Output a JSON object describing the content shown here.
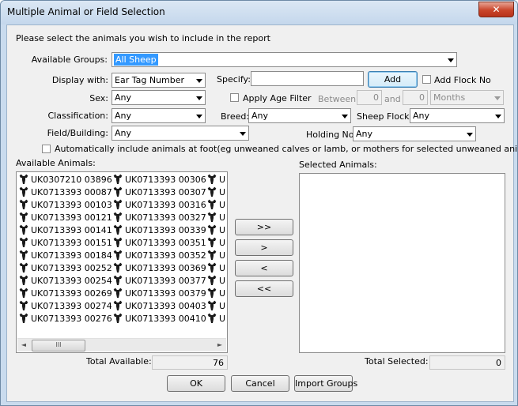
{
  "window": {
    "title": "Multiple Animal or Field Selection",
    "close": "✕"
  },
  "instructions": "Please select the animals you wish to include in the report",
  "groups": {
    "label": "Available Groups:",
    "value": "All Sheep"
  },
  "display": {
    "label": "Display with:",
    "value": "Ear Tag Number"
  },
  "specify": {
    "label": "Specify:",
    "value": ""
  },
  "add_button": "Add",
  "add_flock": "Add Flock No",
  "sex": {
    "label": "Sex:",
    "value": "Any"
  },
  "age_filter": {
    "label": "Apply Age Filter",
    "between": "Between",
    "and": "and",
    "from": "0",
    "to": "0",
    "unit": "Months"
  },
  "classification": {
    "label": "Classification:",
    "value": "Any"
  },
  "breed": {
    "label": "Breed:",
    "value": "Any"
  },
  "flock": {
    "label": "Sheep Flock:",
    "value": "Any"
  },
  "field": {
    "label": "Field/Building:",
    "value": "Any"
  },
  "holding": {
    "label": "Holding No:",
    "value": "Any"
  },
  "auto_include": "Automatically include animals at foot(eg unweaned calves or lamb, or mothers for selected unweaned animals)",
  "available": {
    "label": "Available Animals:",
    "columns": [
      [
        "UK0307210 03896",
        "UK0713393 00087",
        "UK0713393 00103",
        "UK0713393 00121",
        "UK0713393 00141",
        "UK0713393 00151",
        "UK0713393 00184",
        "UK0713393 00252",
        "UK0713393 00254",
        "UK0713393 00269",
        "UK0713393 00274",
        "UK0713393 00276"
      ],
      [
        "UK0713393 00306",
        "UK0713393 00307",
        "UK0713393 00316",
        "UK0713393 00327",
        "UK0713393 00339",
        "UK0713393 00351",
        "UK0713393 00352",
        "UK0713393 00369",
        "UK0713393 00377",
        "UK0713393 00379",
        "UK0713393 00403",
        "UK0713393 00410"
      ],
      [
        "U",
        "U",
        "U",
        "U",
        "U",
        "U",
        "U",
        "U",
        "U",
        "U",
        "U",
        "U"
      ]
    ],
    "total_label": "Total Available:",
    "total": "76"
  },
  "selected": {
    "label": "Selected Animals:",
    "total_label": "Total Selected:",
    "total": "0"
  },
  "transfer": {
    "add_all": ">>",
    "add": ">",
    "remove": "<",
    "remove_all": "<<"
  },
  "buttons": {
    "ok": "OK",
    "cancel": "Cancel",
    "import": "Import Groups"
  },
  "scroll": {
    "left": "◄",
    "right": "►",
    "thumb": "III"
  },
  "icon": "sheep-icon"
}
